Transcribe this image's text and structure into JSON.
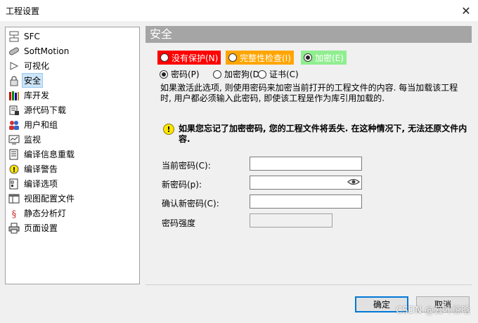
{
  "window": {
    "title": "工程设置",
    "close_glyph": "✕"
  },
  "sidebar": {
    "items": [
      {
        "label": "SFC",
        "icon": "sfc-icon",
        "selected": false
      },
      {
        "label": "SoftMotion",
        "icon": "softmotion-icon",
        "selected": false
      },
      {
        "label": "可视化",
        "icon": "visualization-icon",
        "selected": false
      },
      {
        "label": "安全",
        "icon": "lock-icon",
        "selected": true
      },
      {
        "label": "库开发",
        "icon": "library-icon",
        "selected": false
      },
      {
        "label": "源代码下载",
        "icon": "source-download-icon",
        "selected": false
      },
      {
        "label": "用户和组",
        "icon": "users-icon",
        "selected": false
      },
      {
        "label": "监视",
        "icon": "monitor-icon",
        "selected": false
      },
      {
        "label": "编译信息重载",
        "icon": "compile-info-icon",
        "selected": false
      },
      {
        "label": "编译警告",
        "icon": "warning-icon",
        "selected": false
      },
      {
        "label": "编译选项",
        "icon": "compile-options-icon",
        "selected": false
      },
      {
        "label": "视图配置文件",
        "icon": "view-profile-icon",
        "selected": false
      },
      {
        "label": "静态分析灯",
        "icon": "static-analysis-icon",
        "selected": false
      },
      {
        "label": "页面设置",
        "icon": "printer-icon",
        "selected": false
      }
    ]
  },
  "main": {
    "header": "安全",
    "protection_levels": [
      {
        "label": "没有保护(N)",
        "color": "#ff0000",
        "checked": false
      },
      {
        "label": "完整性检查(I)",
        "color": "#ffa500",
        "checked": false
      },
      {
        "label": "加密(E)",
        "color": "#90ee90",
        "checked": true
      }
    ],
    "methods": [
      {
        "label": "密码(P)",
        "checked": true
      },
      {
        "label": "加密狗(D",
        "checked": false
      },
      {
        "label": "证书(C)",
        "checked": false
      }
    ],
    "description": "如果激活此选项, 则使用密码来加密当前打开的工程文件的内容. 每当加载该工程时, 用户都必须输入此密码, 即使该工程是作为库引用加载的.",
    "warning": "如果您忘记了加密密码, 您的工程文件将丢失. 在这种情况下, 无法还原文件内容.",
    "fields": {
      "current_password": {
        "label": "当前密码(C):",
        "value": ""
      },
      "new_password": {
        "label": "新密码(p):",
        "value": ""
      },
      "confirm_password": {
        "label": "确认新密码(C):",
        "value": ""
      },
      "strength": {
        "label": "密码强度",
        "value": ""
      }
    }
  },
  "buttons": {
    "ok": "确定",
    "cancel": "取消"
  },
  "watermark": "CSDN @云叶惊晗"
}
